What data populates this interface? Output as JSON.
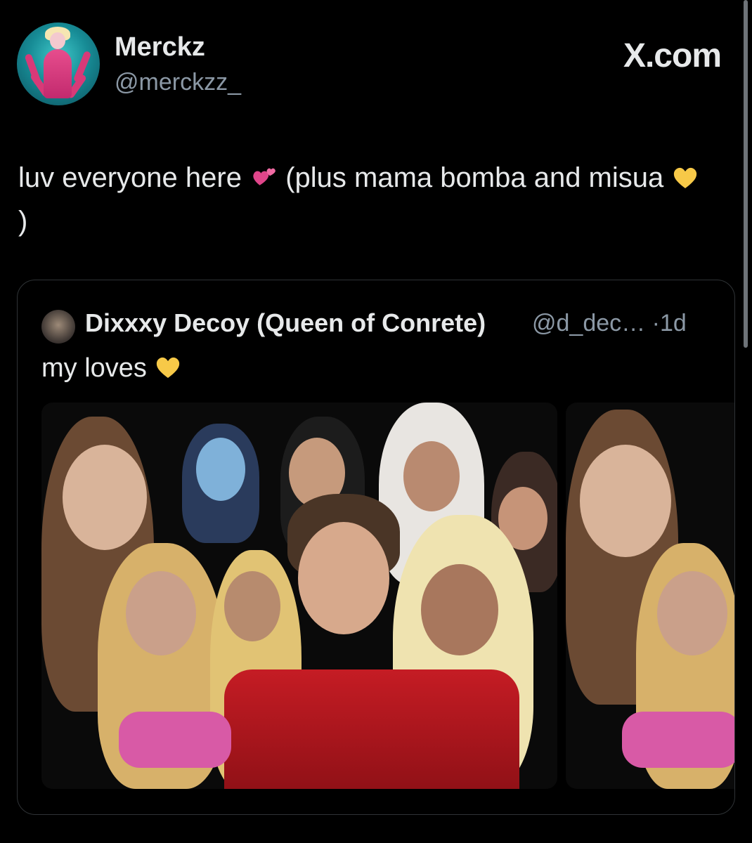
{
  "author": {
    "display_name": "Merckz",
    "handle": "@merckzz_",
    "avatar_icon": "avatar-image"
  },
  "brand": {
    "label": "X.com"
  },
  "tweet": {
    "text_part1": "luv everyone here",
    "text_part2": "(plus mama bomba and misua",
    "text_part3": ")",
    "emoji_1": "two-hearts-icon",
    "emoji_2": "yellow-heart-icon"
  },
  "quoted_tweet": {
    "display_name": "Dixxxy Decoy (Queen of Conrete)",
    "handle_truncated": "@d_dec…",
    "separator": "·",
    "time": "1d",
    "text": "my loves",
    "emoji": "yellow-heart-icon",
    "media_count_visible": 2
  },
  "colors": {
    "background": "#000000",
    "text_primary": "#e7e9ea",
    "text_secondary": "#8b98a5",
    "border": "#2f3336"
  }
}
